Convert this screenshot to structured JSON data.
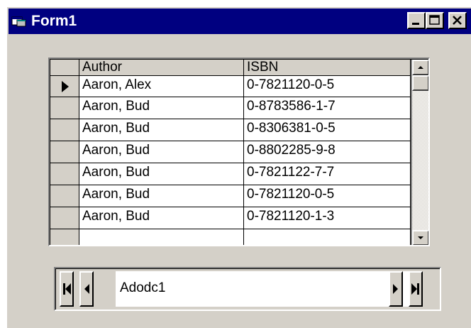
{
  "window": {
    "title": "Form1",
    "title_bar_color": "#000080",
    "face_color": "#d4d0c8",
    "icons": {
      "app": "form-app-icon",
      "minimize": "minimize-icon",
      "maximize": "maximize-icon",
      "close": "close-icon"
    }
  },
  "grid": {
    "columns": [
      "Author",
      "ISBN"
    ],
    "current_row_indicator": "row-pointer-icon",
    "rows": [
      {
        "author": "Aaron, Alex",
        "isbn": "0-7821120-0-5"
      },
      {
        "author": "Aaron, Bud",
        "isbn": "0-8783586-1-7"
      },
      {
        "author": "Aaron, Bud",
        "isbn": "0-8306381-0-5"
      },
      {
        "author": "Aaron, Bud",
        "isbn": "0-8802285-9-8"
      },
      {
        "author": "Aaron, Bud",
        "isbn": "0-7821122-7-7"
      },
      {
        "author": "Aaron, Bud",
        "isbn": "0-7821120-0-5"
      },
      {
        "author": "Aaron, Bud",
        "isbn": "0-7821120-1-3"
      }
    ],
    "selected_row_index": 0
  },
  "adodc": {
    "caption": "Adodc1",
    "buttons": [
      "move-first-icon",
      "move-previous-icon",
      "move-next-icon",
      "move-last-icon"
    ]
  }
}
